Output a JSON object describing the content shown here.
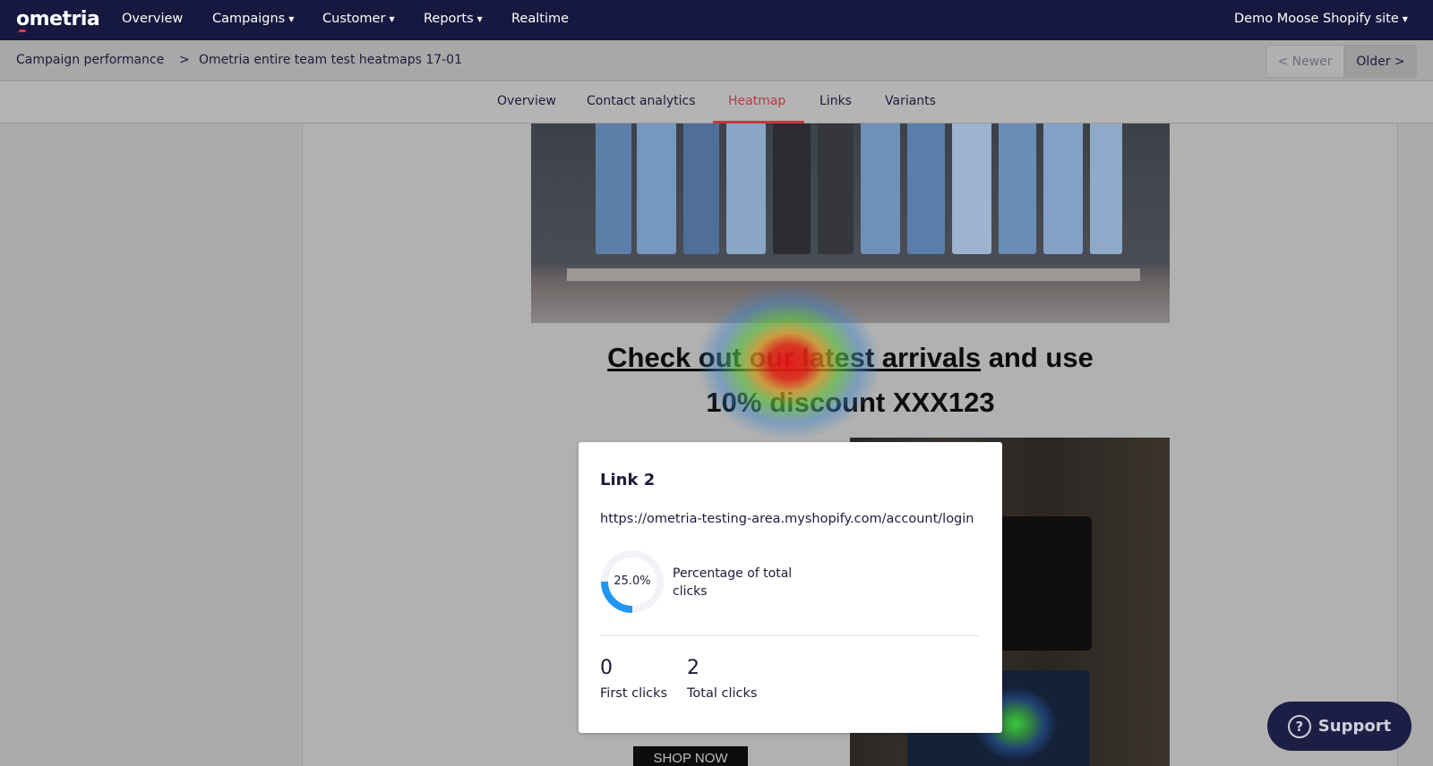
{
  "brand": {
    "logo": "ometria"
  },
  "topnav": {
    "items": [
      {
        "label": "Overview"
      },
      {
        "label": "Campaigns",
        "dropdown": true
      },
      {
        "label": "Customer",
        "dropdown": true
      },
      {
        "label": "Reports",
        "dropdown": true
      },
      {
        "label": "Realtime"
      }
    ],
    "site": "Demo Moose Shopify site"
  },
  "breadcrumb": {
    "parent": "Campaign performance",
    "separator": ">",
    "current": "Ometria entire team test heatmaps 17-01"
  },
  "pager": {
    "newer": "< Newer",
    "older": "Older >"
  },
  "tabs": [
    {
      "label": "Overview"
    },
    {
      "label": "Contact analytics"
    },
    {
      "label": "Heatmap",
      "active": true
    },
    {
      "label": "Links"
    },
    {
      "label": "Variants"
    }
  ],
  "email": {
    "headline_link": "Check out our latest arrivals",
    "headline_rest": " and use",
    "headline_line2": "10% discount XXX123",
    "shop_button": "SHOP NOW"
  },
  "popup": {
    "title": "Link 2",
    "url": "https://ometria-testing-area.myshopify.com/account/login",
    "percentage": 25.0,
    "percentage_label": "25.0%",
    "percentage_desc": "Percentage of total clicks",
    "first_clicks": "0",
    "first_clicks_label": "First clicks",
    "total_clicks": "2",
    "total_clicks_label": "Total clicks"
  },
  "support": {
    "label": "Support"
  },
  "colors": {
    "nav_bg": "#17183f",
    "active_tab": "#c5383f",
    "donut_fill": "#2196f3",
    "donut_track": "#f1f3f6"
  }
}
